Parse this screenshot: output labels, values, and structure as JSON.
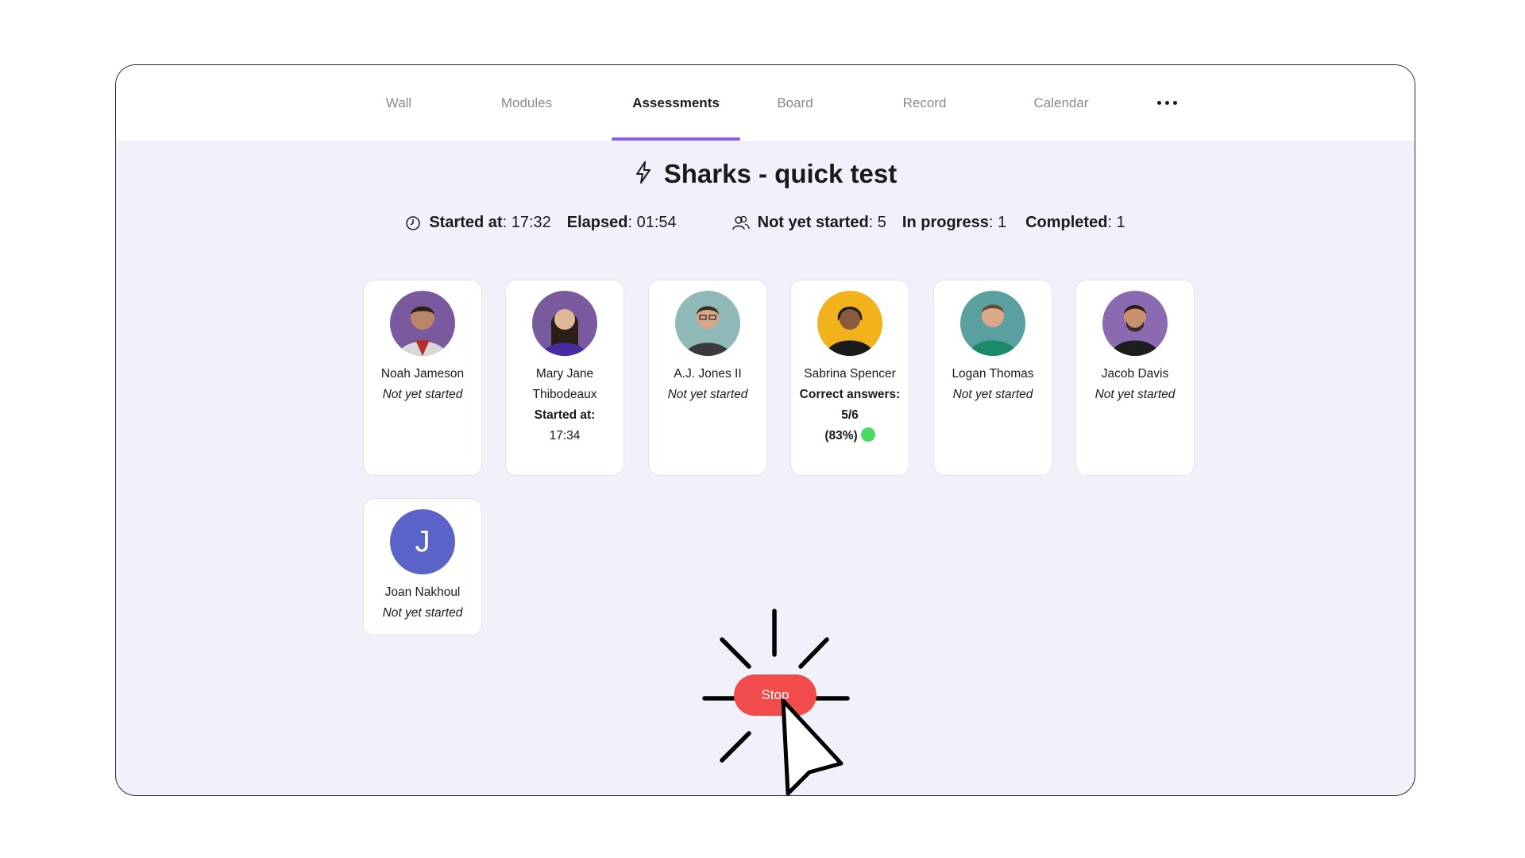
{
  "nav": {
    "tabs": [
      {
        "label": "Wall"
      },
      {
        "label": "Modules"
      },
      {
        "label": "Assessments",
        "active": true
      },
      {
        "label": "Board"
      },
      {
        "label": "Record"
      },
      {
        "label": "Calendar"
      }
    ],
    "more_icon": "more-horizontal-icon"
  },
  "header": {
    "icon": "lightning-bolt-icon",
    "title": "Sharks - quick test"
  },
  "stats": {
    "clock_icon": "clock-icon",
    "started_label": "Started at",
    "started_value": ": 17:32",
    "elapsed_label": "Elapsed",
    "elapsed_value": ": 01:54",
    "people_icon": "users-icon",
    "not_started_label": "Not yet started",
    "not_started_value": ": 5",
    "in_progress_label": "In progress",
    "in_progress_value": ": 1",
    "completed_label": "Completed",
    "completed_value": ": 1"
  },
  "students": [
    {
      "name": "Noah Jameson",
      "status": "Not yet started"
    },
    {
      "name": "Mary Jane Thibodeaux",
      "status_label": "Started at:",
      "status_value": "17:34"
    },
    {
      "name": "A.J. Jones II",
      "status": "Not yet started"
    },
    {
      "name": "Sabrina Spencer",
      "status_label": "Correct answers: 5/6",
      "status_value": "(83%)",
      "status_color": "#4cd964"
    },
    {
      "name": "Logan Thomas",
      "status": "Not yet started"
    },
    {
      "name": "Jacob Davis",
      "status": "Not yet started"
    },
    {
      "name": "Joan Nakhoul",
      "status": "Not yet started",
      "initial": "J"
    }
  ],
  "actions": {
    "stop_label": "Stop"
  },
  "colors": {
    "accent": "#8a5cf0",
    "stop": "#f24b4b",
    "background": "#f1f1fb"
  }
}
